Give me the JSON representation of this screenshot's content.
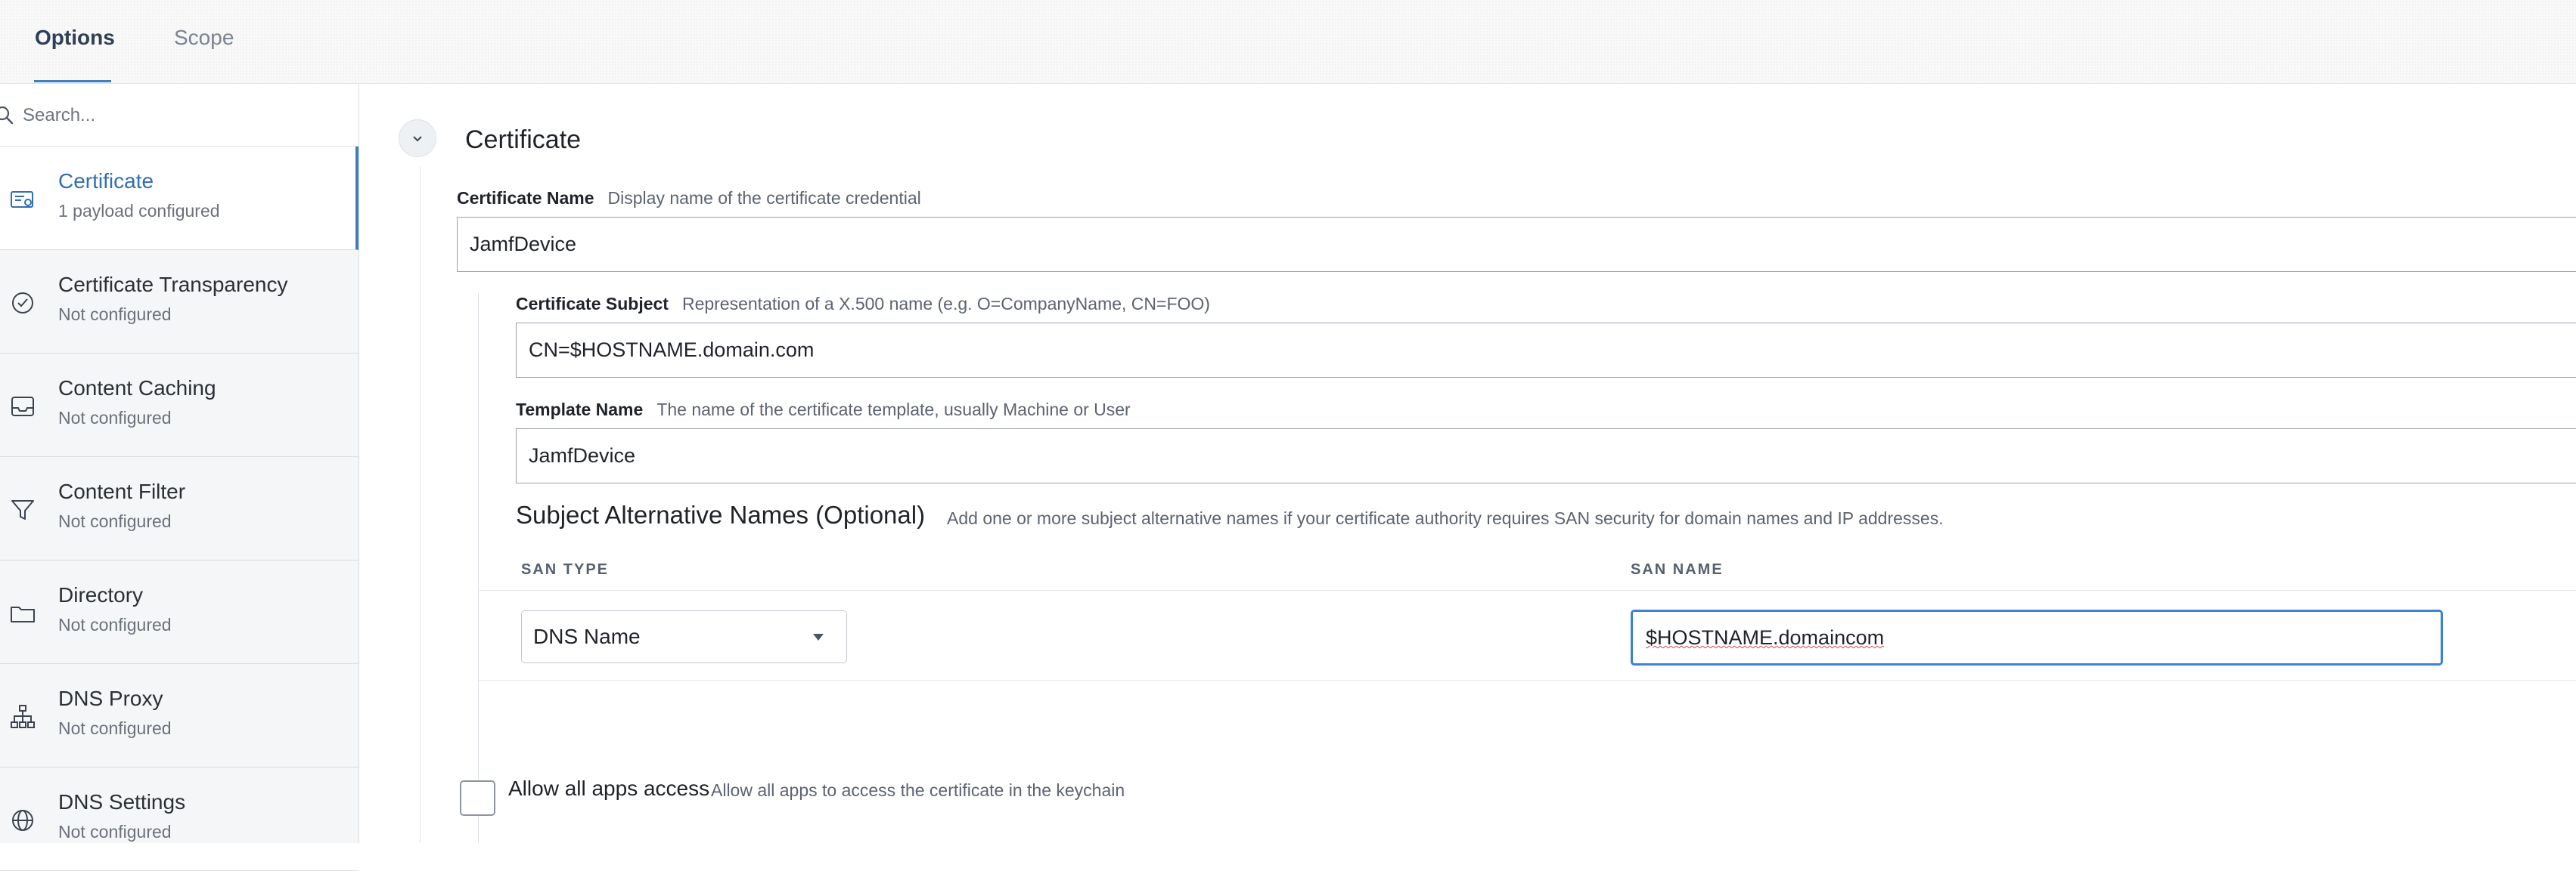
{
  "tabs": [
    {
      "label": "Options",
      "active": true
    },
    {
      "label": "Scope",
      "active": false
    }
  ],
  "search": {
    "placeholder": "Search..."
  },
  "sidebar": {
    "items": [
      {
        "label": "Certificate",
        "status": "1 payload configured",
        "icon": "certificate-icon",
        "active": true
      },
      {
        "label": "Certificate Transparency",
        "status": "Not configured",
        "icon": "check-circle-icon"
      },
      {
        "label": "Content Caching",
        "status": "Not configured",
        "icon": "inbox-tray-icon"
      },
      {
        "label": "Content Filter",
        "status": "Not configured",
        "icon": "filter-icon"
      },
      {
        "label": "Directory",
        "status": "Not configured",
        "icon": "folder-icon"
      },
      {
        "label": "DNS Proxy",
        "status": "Not configured",
        "icon": "network-hierarchy-icon"
      },
      {
        "label": "DNS Settings",
        "status": "Not configured",
        "icon": "globe-icon"
      }
    ]
  },
  "main": {
    "section_title": "Certificate",
    "certificate_name": {
      "label": "Certificate Name",
      "desc": "Display name of the certificate credential",
      "value": "JamfDevice"
    },
    "certificate_subject": {
      "label": "Certificate Subject",
      "desc": "Representation of a X.500 name (e.g. O=CompanyName, CN=FOO)",
      "value": "CN=$HOSTNAME.domain.com"
    },
    "template_name": {
      "label": "Template Name",
      "desc": "The name of the certificate template, usually Machine or User",
      "value": "JamfDevice"
    },
    "san": {
      "title": "Subject Alternative Names (Optional)",
      "desc": "Add one or more subject alternative names if your certificate authority requires SAN security for domain names and IP addresses.",
      "col_type": "SAN TYPE",
      "col_name": "SAN NAME",
      "rows": [
        {
          "type": "DNS Name",
          "name": "$HOSTNAME.domaincom"
        }
      ]
    },
    "allow_all_apps": {
      "label": "Allow all apps access",
      "desc": "Allow all apps to access the certificate in the keychain",
      "checked": false
    }
  },
  "colors": {
    "accent": "#3f7fbf",
    "focus": "#3a84d6",
    "sidebar_bg": "#f5f6f8"
  }
}
